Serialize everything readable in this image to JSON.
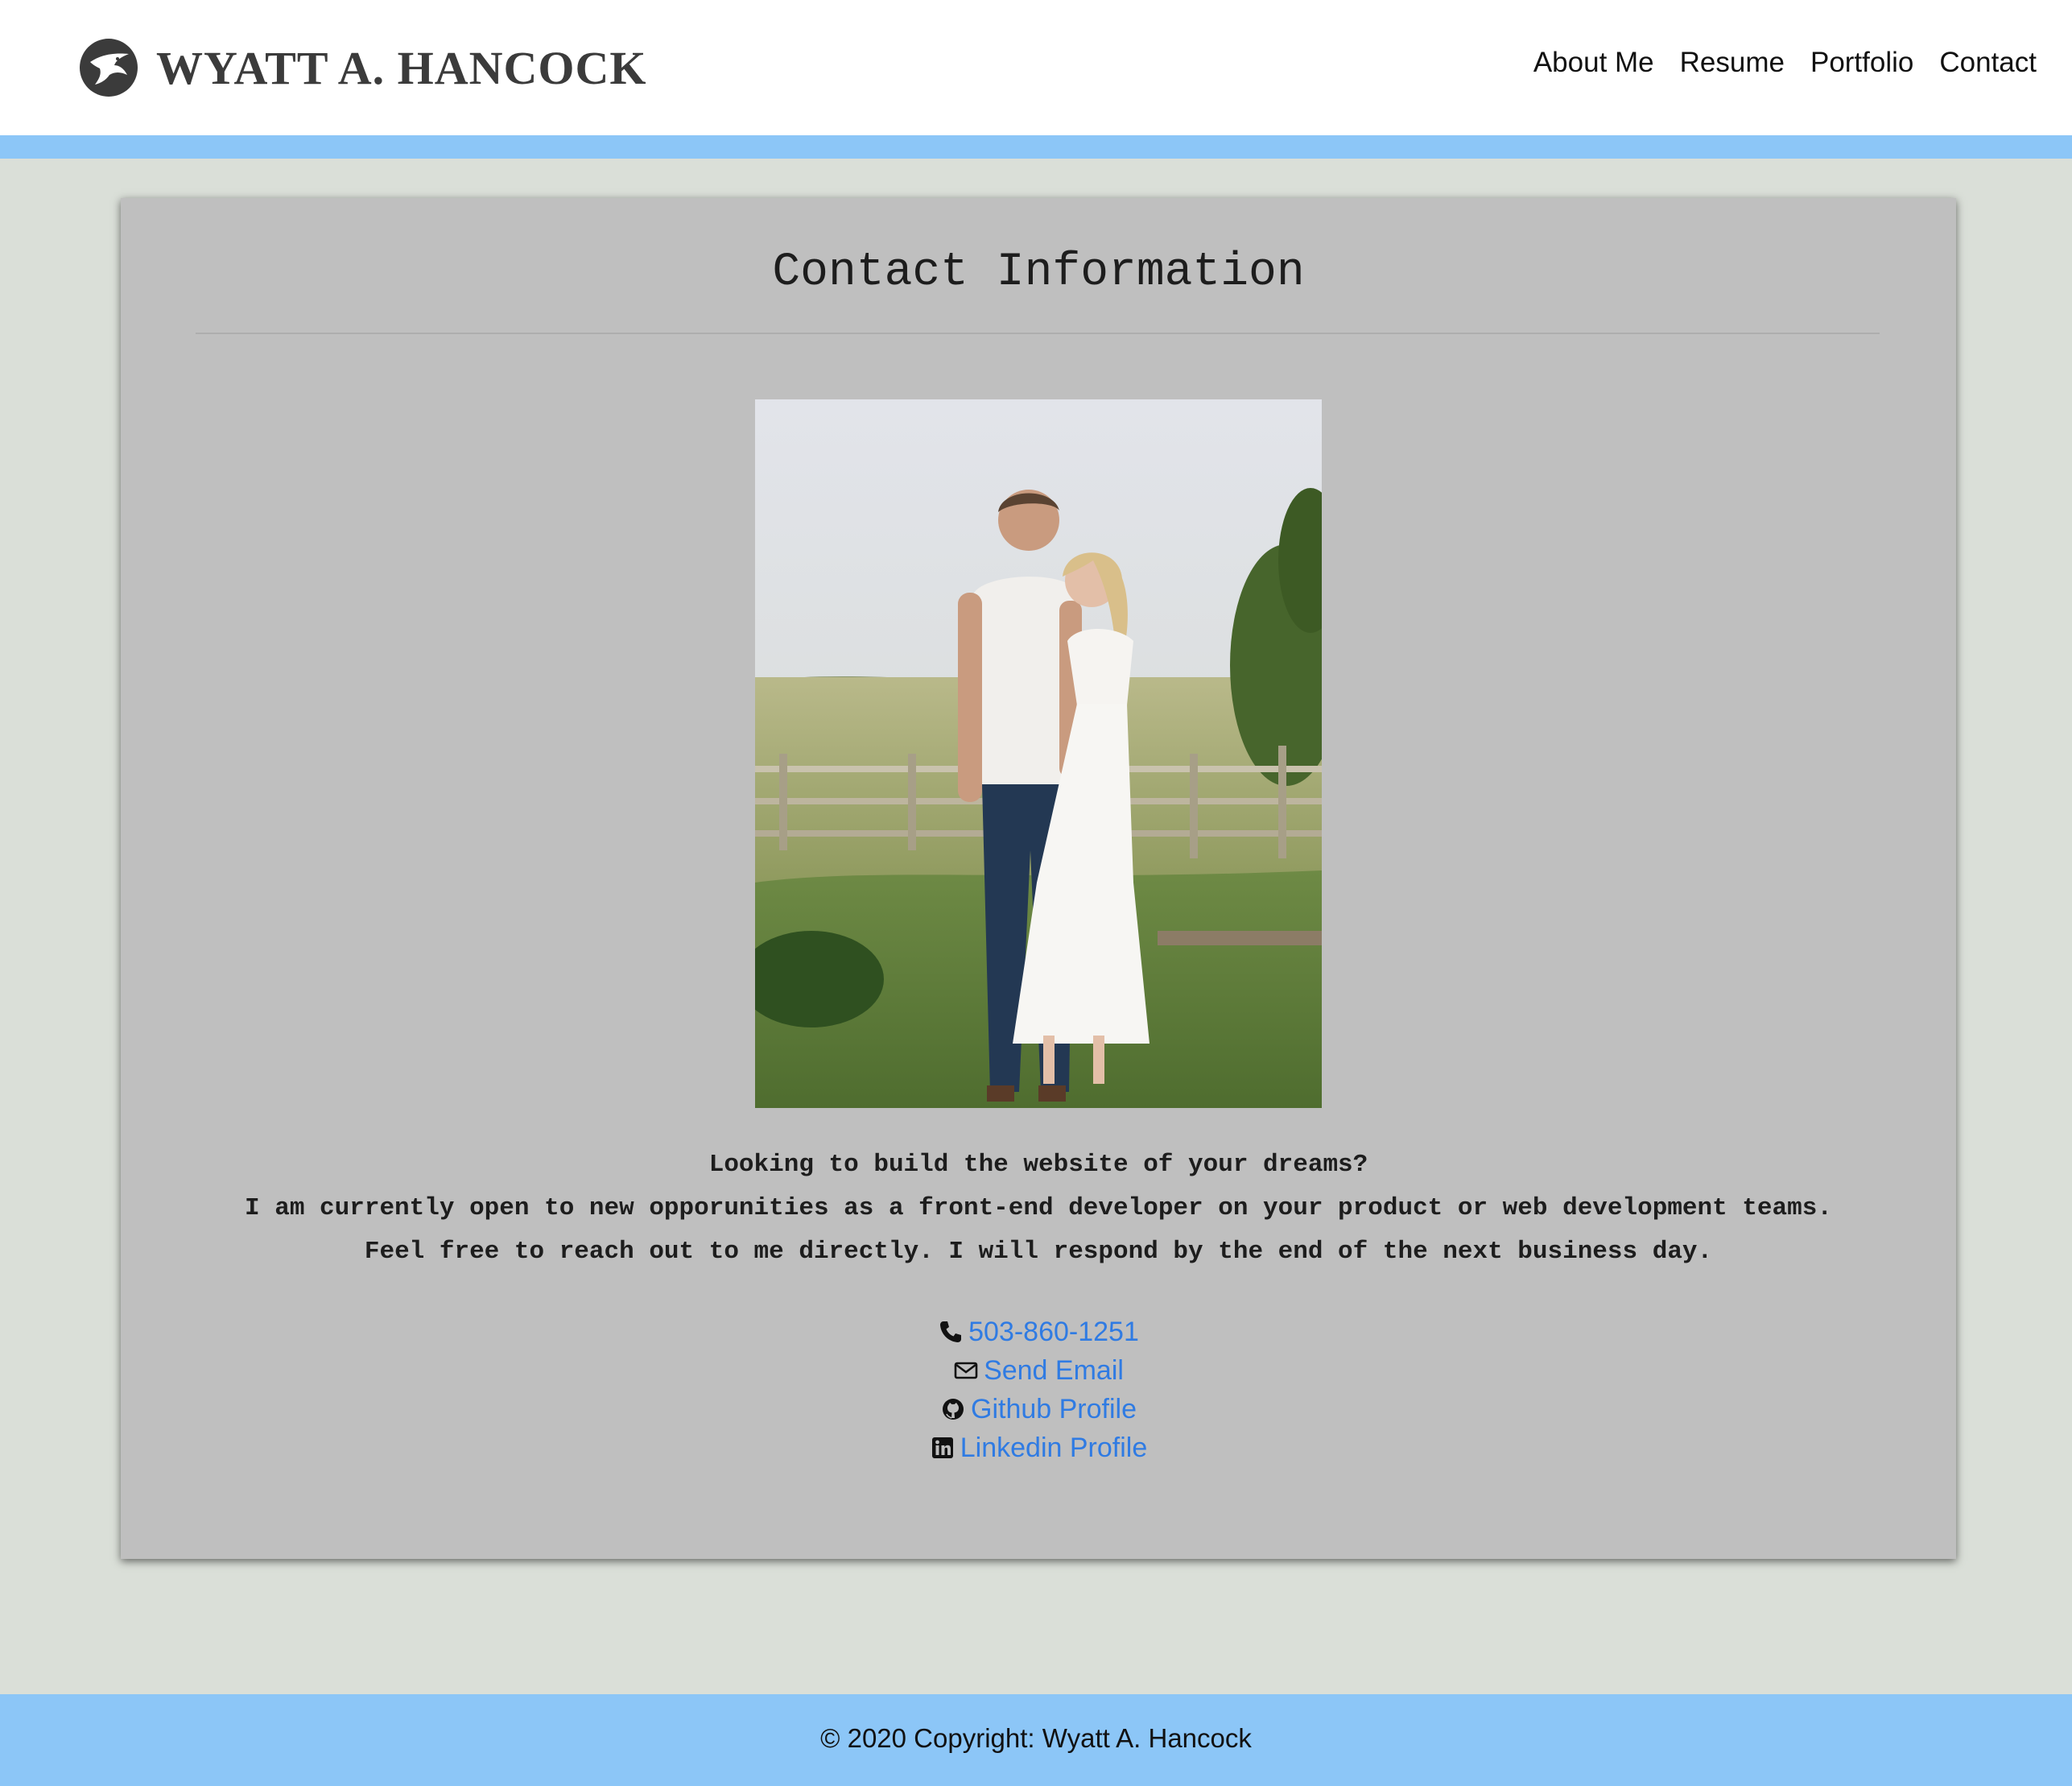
{
  "header": {
    "brand_name": "WYATT A. HANCOCK",
    "brand_logo_icon": "hawk-logo-icon",
    "nav": [
      {
        "label": "About Me"
      },
      {
        "label": "Resume"
      },
      {
        "label": "Portfolio"
      },
      {
        "label": "Contact"
      }
    ]
  },
  "main": {
    "title": "Contact Information",
    "photo_icon": "couple-photo",
    "blurb": [
      "Looking to build the website of your dreams?",
      "I am currently open to new opporunities as a front-end developer on your product or web development teams.",
      "Feel free to reach out to me directly. I will respond by the end of the next business day."
    ],
    "links": [
      {
        "icon": "phone-icon",
        "label": "503-860-1251"
      },
      {
        "icon": "envelope-icon",
        "label": "Send Email"
      },
      {
        "icon": "github-icon",
        "label": "Github Profile"
      },
      {
        "icon": "linkedin-icon",
        "label": "Linkedin Profile"
      }
    ]
  },
  "footer": {
    "copyright": "© 2020 Copyright: Wyatt A. Hancock"
  },
  "colors": {
    "page_background": "#dadfd8",
    "accent_stripe": "#8cc6f7",
    "card_background": "#bfbfbf",
    "link": "#2f7be3"
  }
}
